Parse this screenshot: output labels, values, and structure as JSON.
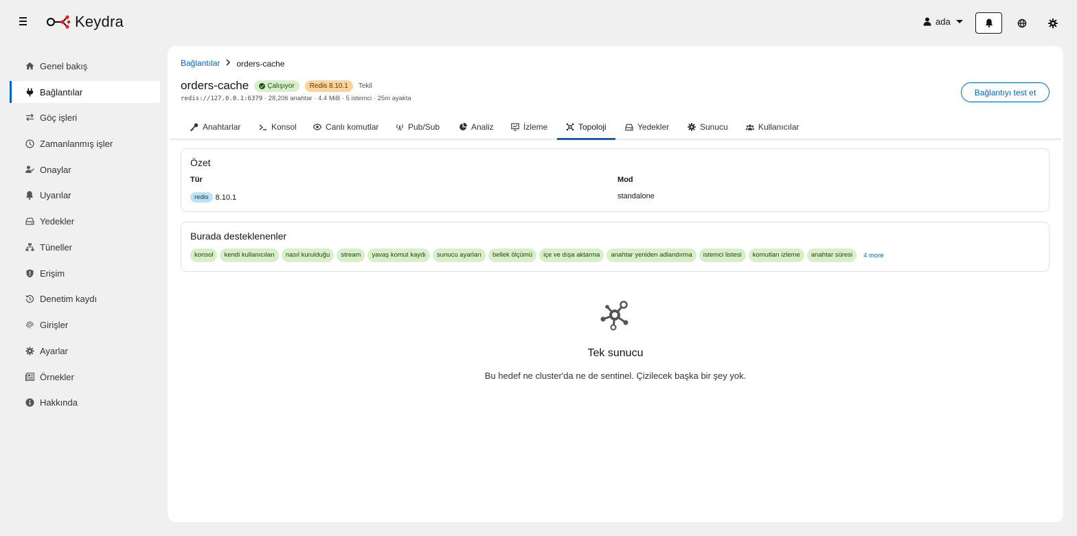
{
  "app": {
    "name": "Keydra"
  },
  "user": {
    "name": "ada"
  },
  "sidebar": {
    "items": [
      {
        "label": "Genel bakış",
        "icon": "home-icon"
      },
      {
        "label": "Bağlantılar",
        "icon": "plug-icon",
        "active": true
      },
      {
        "label": "Göç işleri",
        "icon": "exchange-icon"
      },
      {
        "label": "Zamanlanmış işler",
        "icon": "clock-icon"
      },
      {
        "label": "Onaylar",
        "icon": "user-check-icon"
      },
      {
        "label": "Uyarılar",
        "icon": "bell-icon"
      },
      {
        "label": "Yedekler",
        "icon": "hdd-icon"
      },
      {
        "label": "Tüneller",
        "icon": "network-icon"
      },
      {
        "label": "Erişim",
        "icon": "shield-icon"
      },
      {
        "label": "Denetim kaydı",
        "icon": "history-icon"
      },
      {
        "label": "Girişler",
        "icon": "fingerprint-icon"
      },
      {
        "label": "Ayarlar",
        "icon": "gear-icon"
      },
      {
        "label": "Örnekler",
        "icon": "newspaper-icon"
      },
      {
        "label": "Hakkında",
        "icon": "info-icon"
      }
    ]
  },
  "breadcrumb": {
    "parent": "Bağlantılar",
    "current": "orders-cache"
  },
  "connection": {
    "name": "orders-cache",
    "status": "Çalışıyor",
    "version_badge": "Redis 8.10.1",
    "mode_label": "Tekil",
    "address": "redis://127.0.0.1:6379",
    "stats": " · 28,206 anahtar · 4.4 MiB · 5 istemci · 25m ayakta"
  },
  "actions": {
    "test_connection": "Bağlantıyı test et"
  },
  "tabs": [
    {
      "label": "Anahtarlar",
      "icon": "key-icon"
    },
    {
      "label": "Konsol",
      "icon": "terminal-icon"
    },
    {
      "label": "Canlı komutlar",
      "icon": "eye-icon"
    },
    {
      "label": "Pub/Sub",
      "icon": "broadcast-icon"
    },
    {
      "label": "Analiz",
      "icon": "pie-chart-icon"
    },
    {
      "label": "İzleme",
      "icon": "monitor-chart-icon"
    },
    {
      "label": "Topoloji",
      "icon": "topology-icon",
      "active": true
    },
    {
      "label": "Yedekler",
      "icon": "hdd-icon"
    },
    {
      "label": "Sunucu",
      "icon": "gear-icon"
    },
    {
      "label": "Kullanıcılar",
      "icon": "users-icon"
    }
  ],
  "summary": {
    "title": "Özet",
    "type_label": "Tür",
    "type_chip": "redis",
    "type_version": "8.10.1",
    "mode_label": "Mod",
    "mode_value": "standalone"
  },
  "supported": {
    "title": "Burada desteklenenler",
    "chips": [
      "konsol",
      "kendi kullanıcıları",
      "nasıl kurulduğu",
      "stream",
      "yavaş komut kaydı",
      "sunucu ayarları",
      "bellek ölçümü",
      "içe ve dışa aktarma",
      "anahtar yeniden adlandırma",
      "istemci listesi",
      "komutları izleme",
      "anahtar süresi"
    ],
    "more": "4 more"
  },
  "empty_state": {
    "title": "Tek sunucu",
    "text": "Bu hedef ne cluster'da ne de sentinel. Çizilecek başka bir şey yok."
  },
  "colors": {
    "accent": "#0066cc",
    "logo_accent": "#e8201c",
    "running_badge": "#d7f0c8",
    "redis_badge": "#fbd39b"
  }
}
